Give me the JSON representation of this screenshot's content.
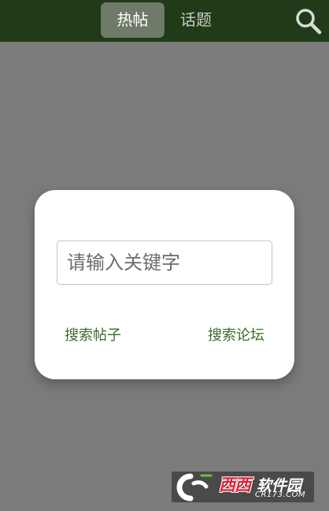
{
  "tabs": [
    {
      "label": "热帖",
      "active": true
    },
    {
      "label": "话题",
      "active": false
    }
  ],
  "header": {
    "search_icon": "search-icon"
  },
  "dialog": {
    "placeholder": "请输入关键字",
    "value": "",
    "search_posts_label": "搜索帖子",
    "search_forum_label": "搜索论坛"
  },
  "watermark": {
    "brand": "西西",
    "name": "软件园",
    "url": "CR173.COM"
  },
  "colors": {
    "topbar": "#213a18",
    "overlay": "#7b7b7b",
    "accent_text": "#3c6b2c",
    "active_tab": "#6f7a68"
  }
}
